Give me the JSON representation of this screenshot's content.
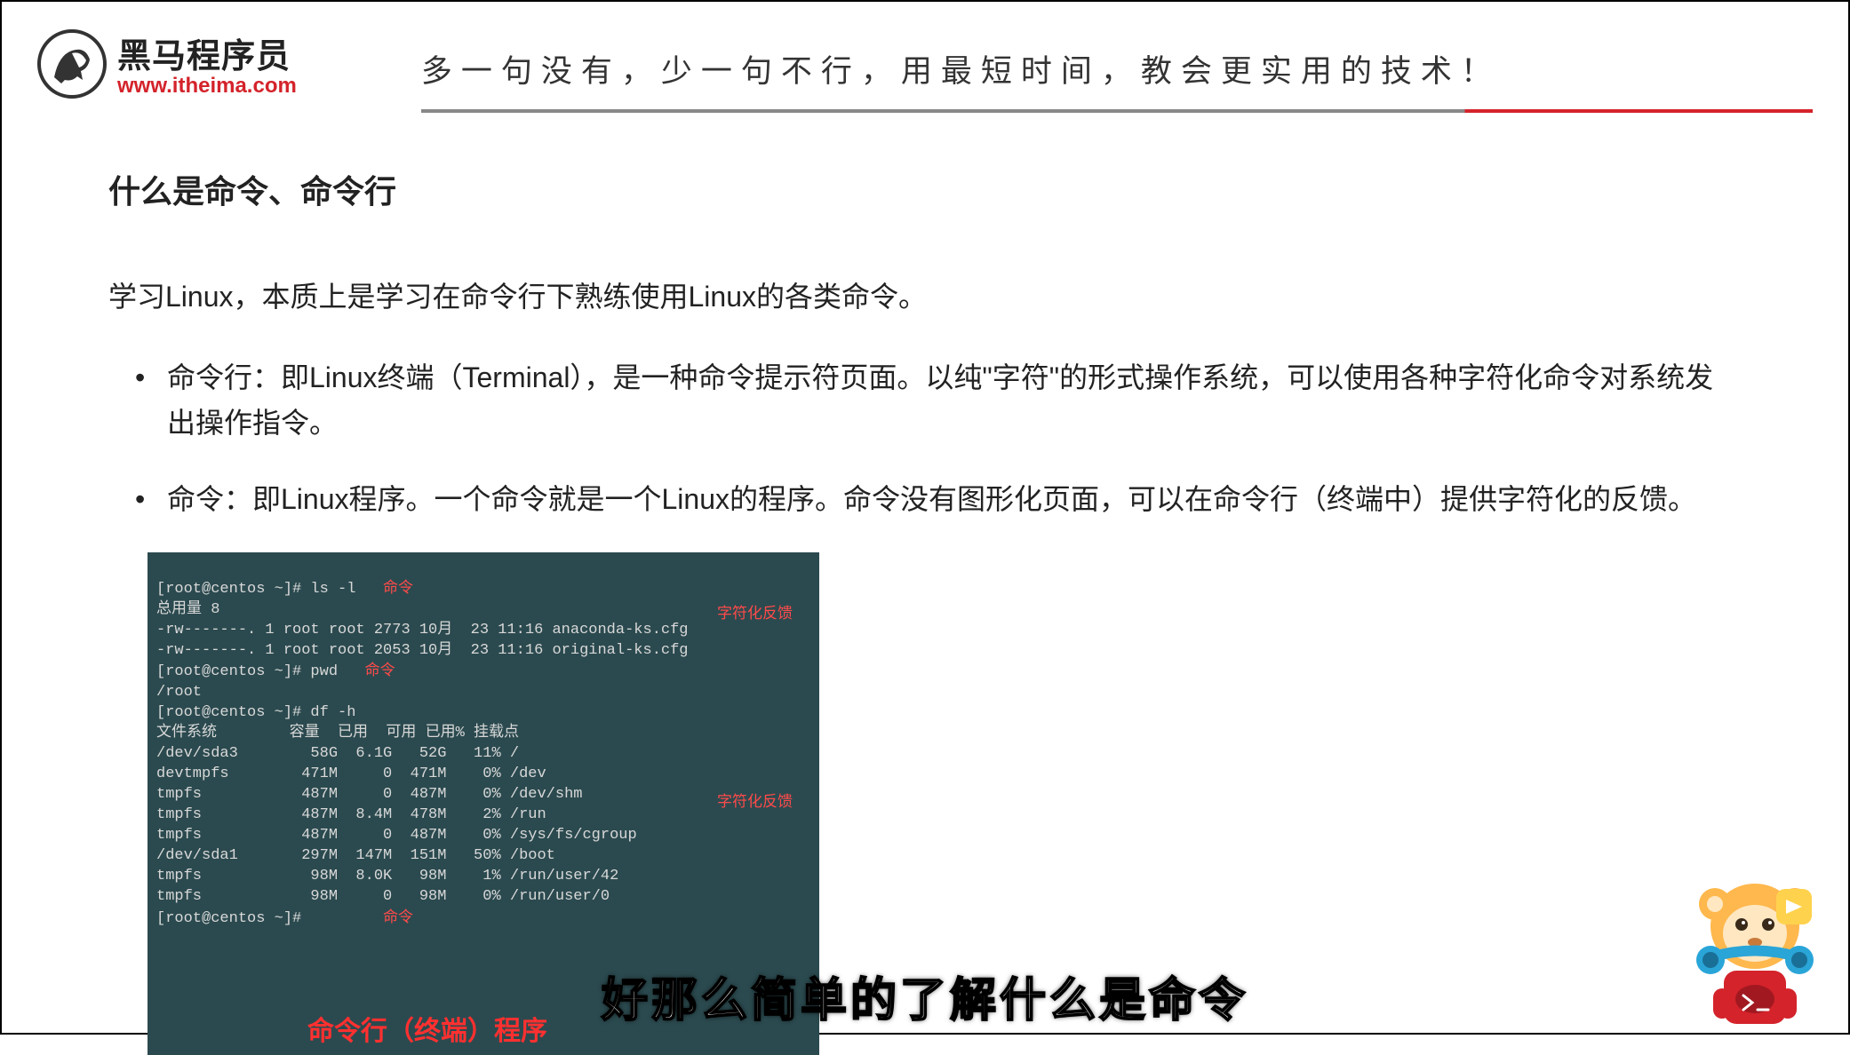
{
  "header": {
    "logo_cn": "黑马程序员",
    "logo_url": "www.itheima.com",
    "slogan": "多一句没有，少一句不行，用最短时间，教会更实用的技术！"
  },
  "section": {
    "title": "什么是命令、命令行",
    "intro": "学习Linux，本质上是学习在命令行下熟练使用Linux的各类命令。",
    "bullets": [
      "命令行：即Linux终端（Terminal），是一种命令提示符页面。以纯\"字符\"的形式操作系统，可以使用各种字符化命令对系统发出操作指令。",
      "命令：即Linux程序。一个命令就是一个Linux的程序。命令没有图形化页面，可以在命令行（终端中）提供字符化的反馈。"
    ]
  },
  "terminal": {
    "lines": [
      "[root@centos ~]# ls -l",
      "总用量 8",
      "-rw-------. 1 root root 2773 10月  23 11:16 anaconda-ks.cfg",
      "-rw-------. 1 root root 2053 10月  23 11:16 original-ks.cfg",
      "[root@centos ~]# pwd",
      "/root",
      "[root@centos ~]# df -h",
      "文件系统        容量  已用  可用 已用% 挂载点",
      "/dev/sda3        58G  6.1G   52G   11% /",
      "devtmpfs        471M     0  471M    0% /dev",
      "tmpfs           487M     0  487M    0% /dev/shm",
      "tmpfs           487M  8.4M  478M    2% /run",
      "tmpfs           487M     0  487M    0% /sys/fs/cgroup",
      "/dev/sda1       297M  147M  151M   50% /boot",
      "tmpfs            98M  8.0K   98M    1% /run/user/42",
      "tmpfs            98M     0   98M    0% /run/user/0",
      "[root@centos ~]#"
    ],
    "ann_cmd": "命令",
    "ann_feedback": "字符化反馈",
    "ann_bottom": "命令行（终端）程序"
  },
  "subtitle": "好那么简单的了解什么是命令"
}
